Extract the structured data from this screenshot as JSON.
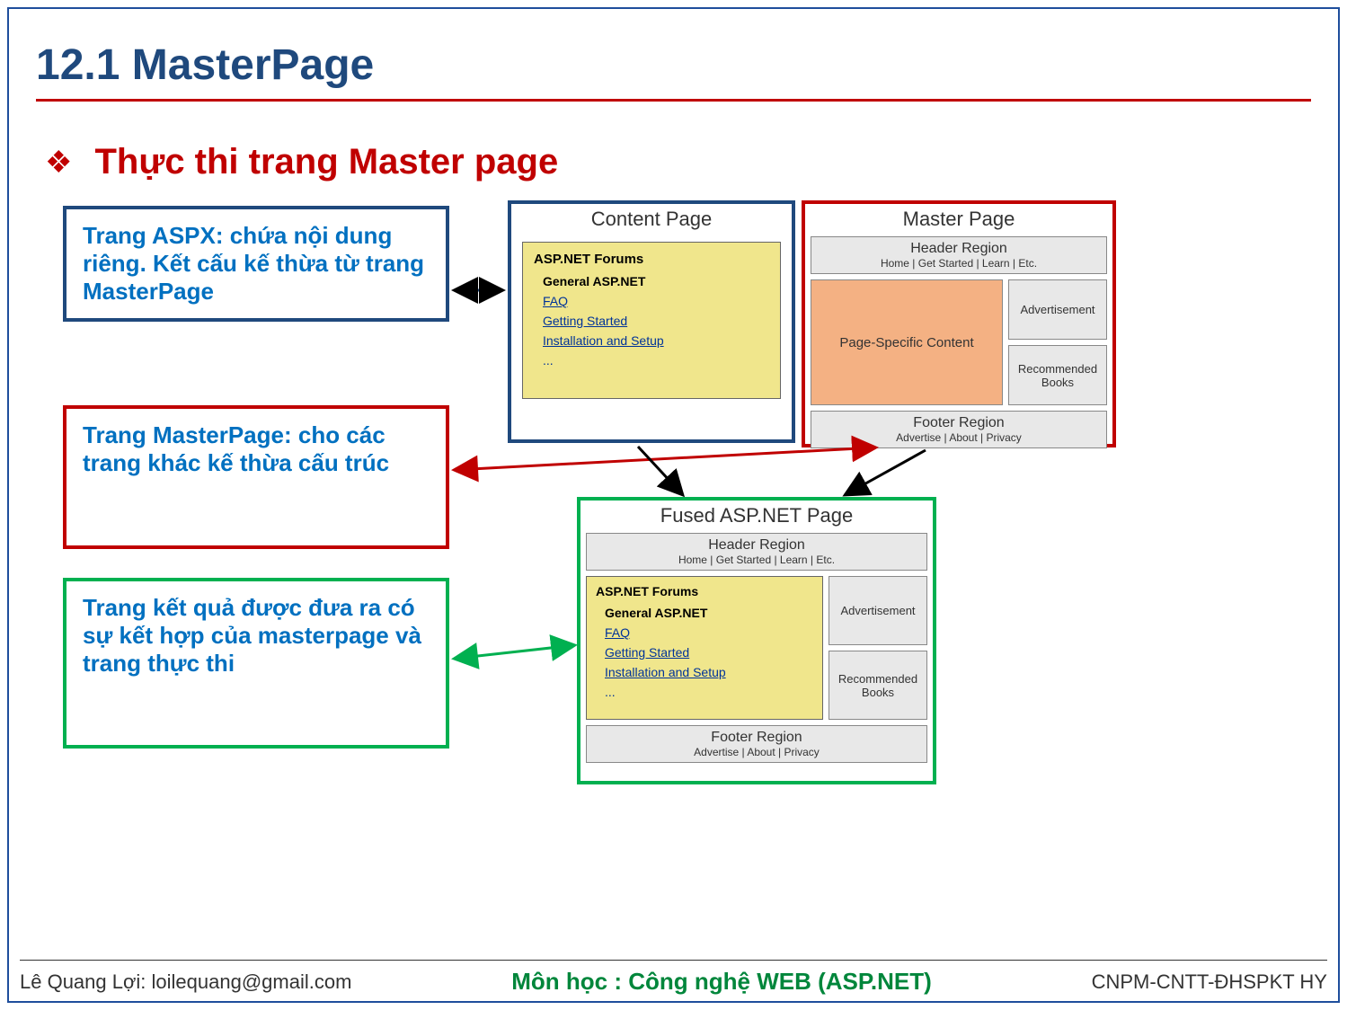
{
  "title": "12.1 MasterPage",
  "bullet": "Thực thi trang Master page",
  "descriptions": {
    "aspx": "Trang ASPX: chứa nội dung riêng. Kết cấu kế thừa từ trang MasterPage",
    "master": "Trang MasterPage: cho các trang khác kế thừa cấu trúc",
    "fused": "Trang  kết quả được đưa ra có sự kết hợp của masterpage  và trang thực thi"
  },
  "contentPage": {
    "title": "Content Page",
    "forumTitle": "ASP.NET Forums",
    "forumSub": "General ASP.NET",
    "links": [
      "FAQ",
      "Getting Started",
      "Installation and Setup"
    ],
    "ellipsis": "..."
  },
  "masterPage": {
    "title": "Master Page",
    "header": "Header Region",
    "headerSub": "Home | Get Started | Learn | Etc.",
    "pageSpecific": "Page-Specific Content",
    "ad": "Advertisement",
    "books": "Recommended Books",
    "footer": "Footer Region",
    "footerSub": "Advertise | About | Privacy"
  },
  "fusedPage": {
    "title": "Fused ASP.NET Page",
    "header": "Header Region",
    "headerSub": "Home | Get Started | Learn | Etc.",
    "forumTitle": "ASP.NET Forums",
    "forumSub": "General ASP.NET",
    "links": [
      "FAQ",
      "Getting Started",
      "Installation and Setup"
    ],
    "ellipsis": "...",
    "ad": "Advertisement",
    "books": "Recommended Books",
    "footer": "Footer Region",
    "footerSub": "Advertise | About | Privacy"
  },
  "footer": {
    "left": "Lê Quang Lợi: loilequang@gmail.com",
    "mid": "Môn học : Công nghệ WEB (ASP.NET)",
    "right": "CNPM-CNTT-ĐHSPKT HY"
  }
}
